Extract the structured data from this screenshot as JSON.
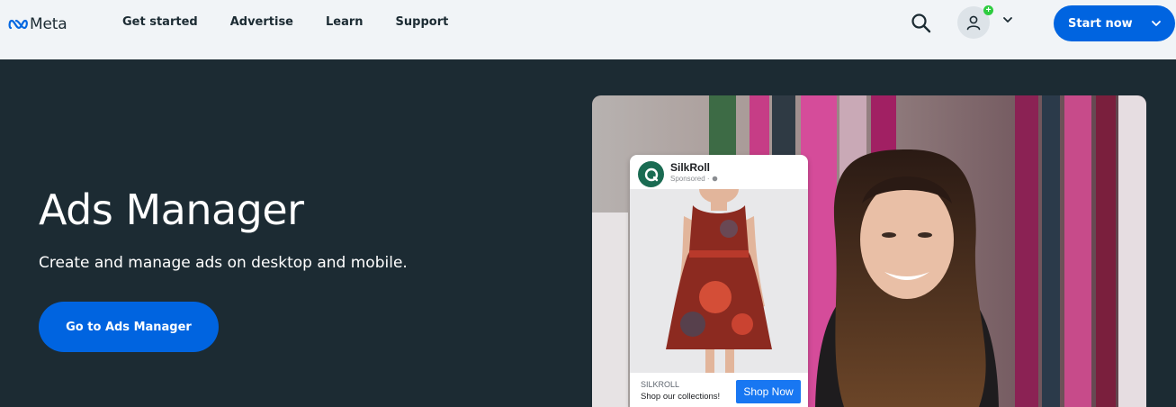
{
  "header": {
    "logo_text": "Meta",
    "nav": [
      "Get started",
      "Advertise",
      "Learn",
      "Support"
    ],
    "search_icon": "search-icon",
    "account_icon": "user-icon",
    "account_badge": "+",
    "start_button_label": "Start now"
  },
  "hero": {
    "title": "Ads Manager",
    "subtitle": "Create and manage ads on desktop and mobile.",
    "cta_label": "Go to Ads Manager"
  },
  "ad_preview": {
    "brand": "SilkRoll",
    "sponsored": "Sponsored · ",
    "footer_name": "SILKROLL",
    "footer_text": "Shop our collections!",
    "shop_button_label": "Shop Now"
  },
  "colors": {
    "header_bg": "#f1f4f7",
    "hero_bg": "#1c2b33",
    "accent_blue": "#0064e0",
    "ad_button_blue": "#1877f2",
    "badge_green": "#2ecc40"
  }
}
